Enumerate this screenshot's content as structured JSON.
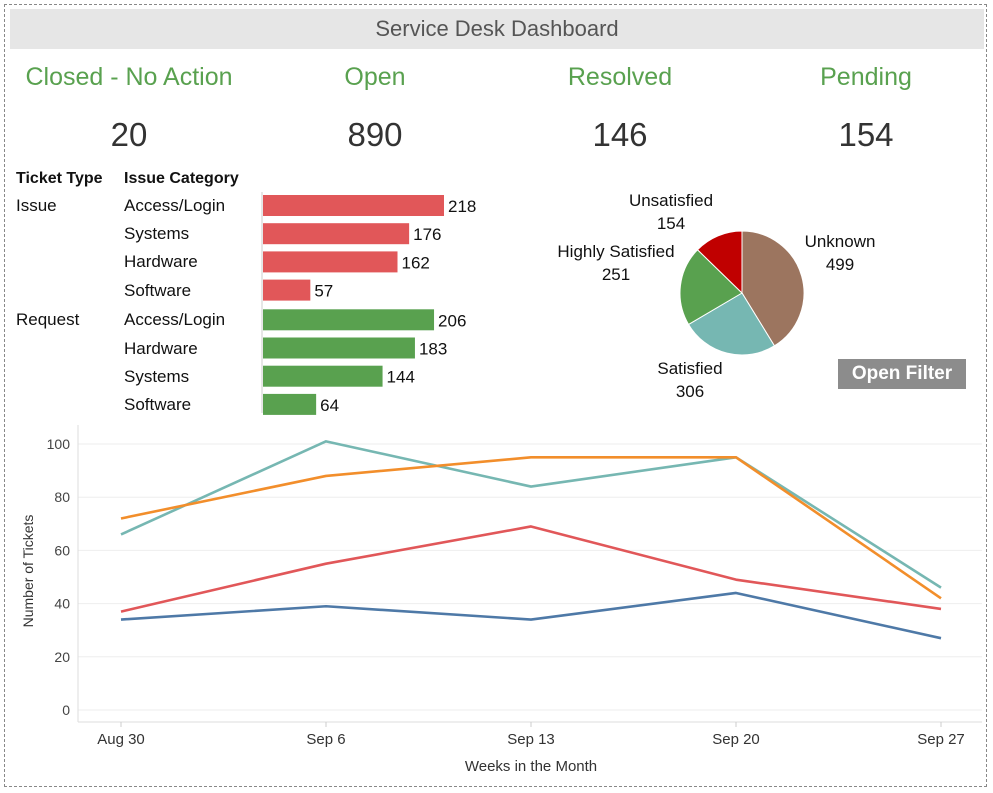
{
  "header": {
    "title": "Service Desk Dashboard"
  },
  "kpis": [
    {
      "label": "Closed - No Action",
      "value": "20"
    },
    {
      "label": "Open",
      "value": "890"
    },
    {
      "label": "Resolved",
      "value": "146"
    },
    {
      "label": "Pending",
      "value": "154"
    }
  ],
  "filter_button": {
    "label": "Open Filter"
  },
  "colors": {
    "issue": "#e15759",
    "request": "#59a14f",
    "kpi": "#59a14f"
  },
  "chart_data": [
    {
      "type": "bar",
      "columns": [
        "Ticket Type",
        "Issue Category"
      ],
      "rows": [
        {
          "ticket_type": "Issue",
          "category": "Access/Login",
          "value": 218
        },
        {
          "ticket_type": "",
          "category": "Systems",
          "value": 176
        },
        {
          "ticket_type": "",
          "category": "Hardware",
          "value": 162
        },
        {
          "ticket_type": "",
          "category": "Software",
          "value": 57
        },
        {
          "ticket_type": "Request",
          "category": "Access/Login",
          "value": 206
        },
        {
          "ticket_type": "",
          "category": "Hardware",
          "value": 183
        },
        {
          "ticket_type": "",
          "category": "Systems",
          "value": 144
        },
        {
          "ticket_type": "",
          "category": "Software",
          "value": 64
        }
      ],
      "xlim": [
        0,
        300
      ]
    },
    {
      "type": "pie",
      "slices": [
        {
          "label": "Unknown",
          "value": 499,
          "color": "#9c755f"
        },
        {
          "label": "Satisfied",
          "value": 306,
          "color": "#76b7b2"
        },
        {
          "label": "Highly Satisfied",
          "value": 251,
          "color": "#59a14f"
        },
        {
          "label": "Unsatisfied",
          "value": 154,
          "color": "#c00000"
        }
      ]
    },
    {
      "type": "line",
      "xlabel": "Weeks in the Month",
      "ylabel": "Number of Tickets",
      "x": [
        "Aug 30",
        "Sep 6",
        "Sep 13",
        "Sep 20",
        "Sep 27"
      ],
      "ylim": [
        0,
        105
      ],
      "yticks": [
        0,
        20,
        40,
        60,
        80,
        100
      ],
      "grid": true,
      "series": [
        {
          "color": "#76b7b2",
          "values": [
            66,
            101,
            84,
            95,
            46
          ]
        },
        {
          "color": "#f28e2b",
          "values": [
            72,
            88,
            95,
            95,
            42
          ]
        },
        {
          "color": "#e15759",
          "values": [
            37,
            55,
            69,
            49,
            38
          ]
        },
        {
          "color": "#4e79a7",
          "values": [
            34,
            39,
            34,
            44,
            27
          ]
        }
      ]
    }
  ]
}
